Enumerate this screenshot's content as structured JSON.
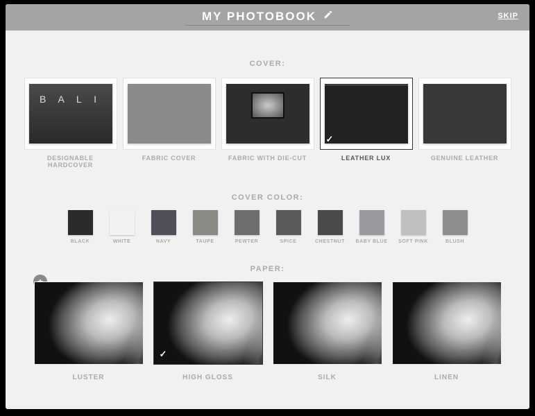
{
  "header": {
    "title": "MY PHOTOBOOK",
    "skip": "SKIP"
  },
  "sections": {
    "cover": "COVER:",
    "color": "COVER COLOR:",
    "paper": "PAPER:"
  },
  "covers": [
    {
      "label": "DESIGNABLE HARDCOVER"
    },
    {
      "label": "FABRIC COVER"
    },
    {
      "label": "FABRIC WITH DIE-CUT"
    },
    {
      "label": "LEATHER LUX",
      "selected": true
    },
    {
      "label": "GENUINE LEATHER"
    }
  ],
  "colors": [
    {
      "label": "BLACK",
      "hex": "#2b2b2b"
    },
    {
      "label": "WHITE",
      "hex": "#f2f2f2"
    },
    {
      "label": "NAVY",
      "hex": "#4f4f57"
    },
    {
      "label": "TAUPE",
      "hex": "#8a8a84"
    },
    {
      "label": "PEWTER",
      "hex": "#6e6e6e"
    },
    {
      "label": "SPICE",
      "hex": "#5a5a5a"
    },
    {
      "label": "CHESTNUT",
      "hex": "#4a4a4a"
    },
    {
      "label": "BABY BLUE",
      "hex": "#9a9a9e"
    },
    {
      "label": "SOFT PINK",
      "hex": "#bfbfbf"
    },
    {
      "label": "BLUSH",
      "hex": "#8e8e8e"
    }
  ],
  "papers": [
    {
      "label": "LUSTER"
    },
    {
      "label": "HIGH GLOSS",
      "selected": true
    },
    {
      "label": "SILK"
    },
    {
      "label": "LINEN"
    }
  ]
}
